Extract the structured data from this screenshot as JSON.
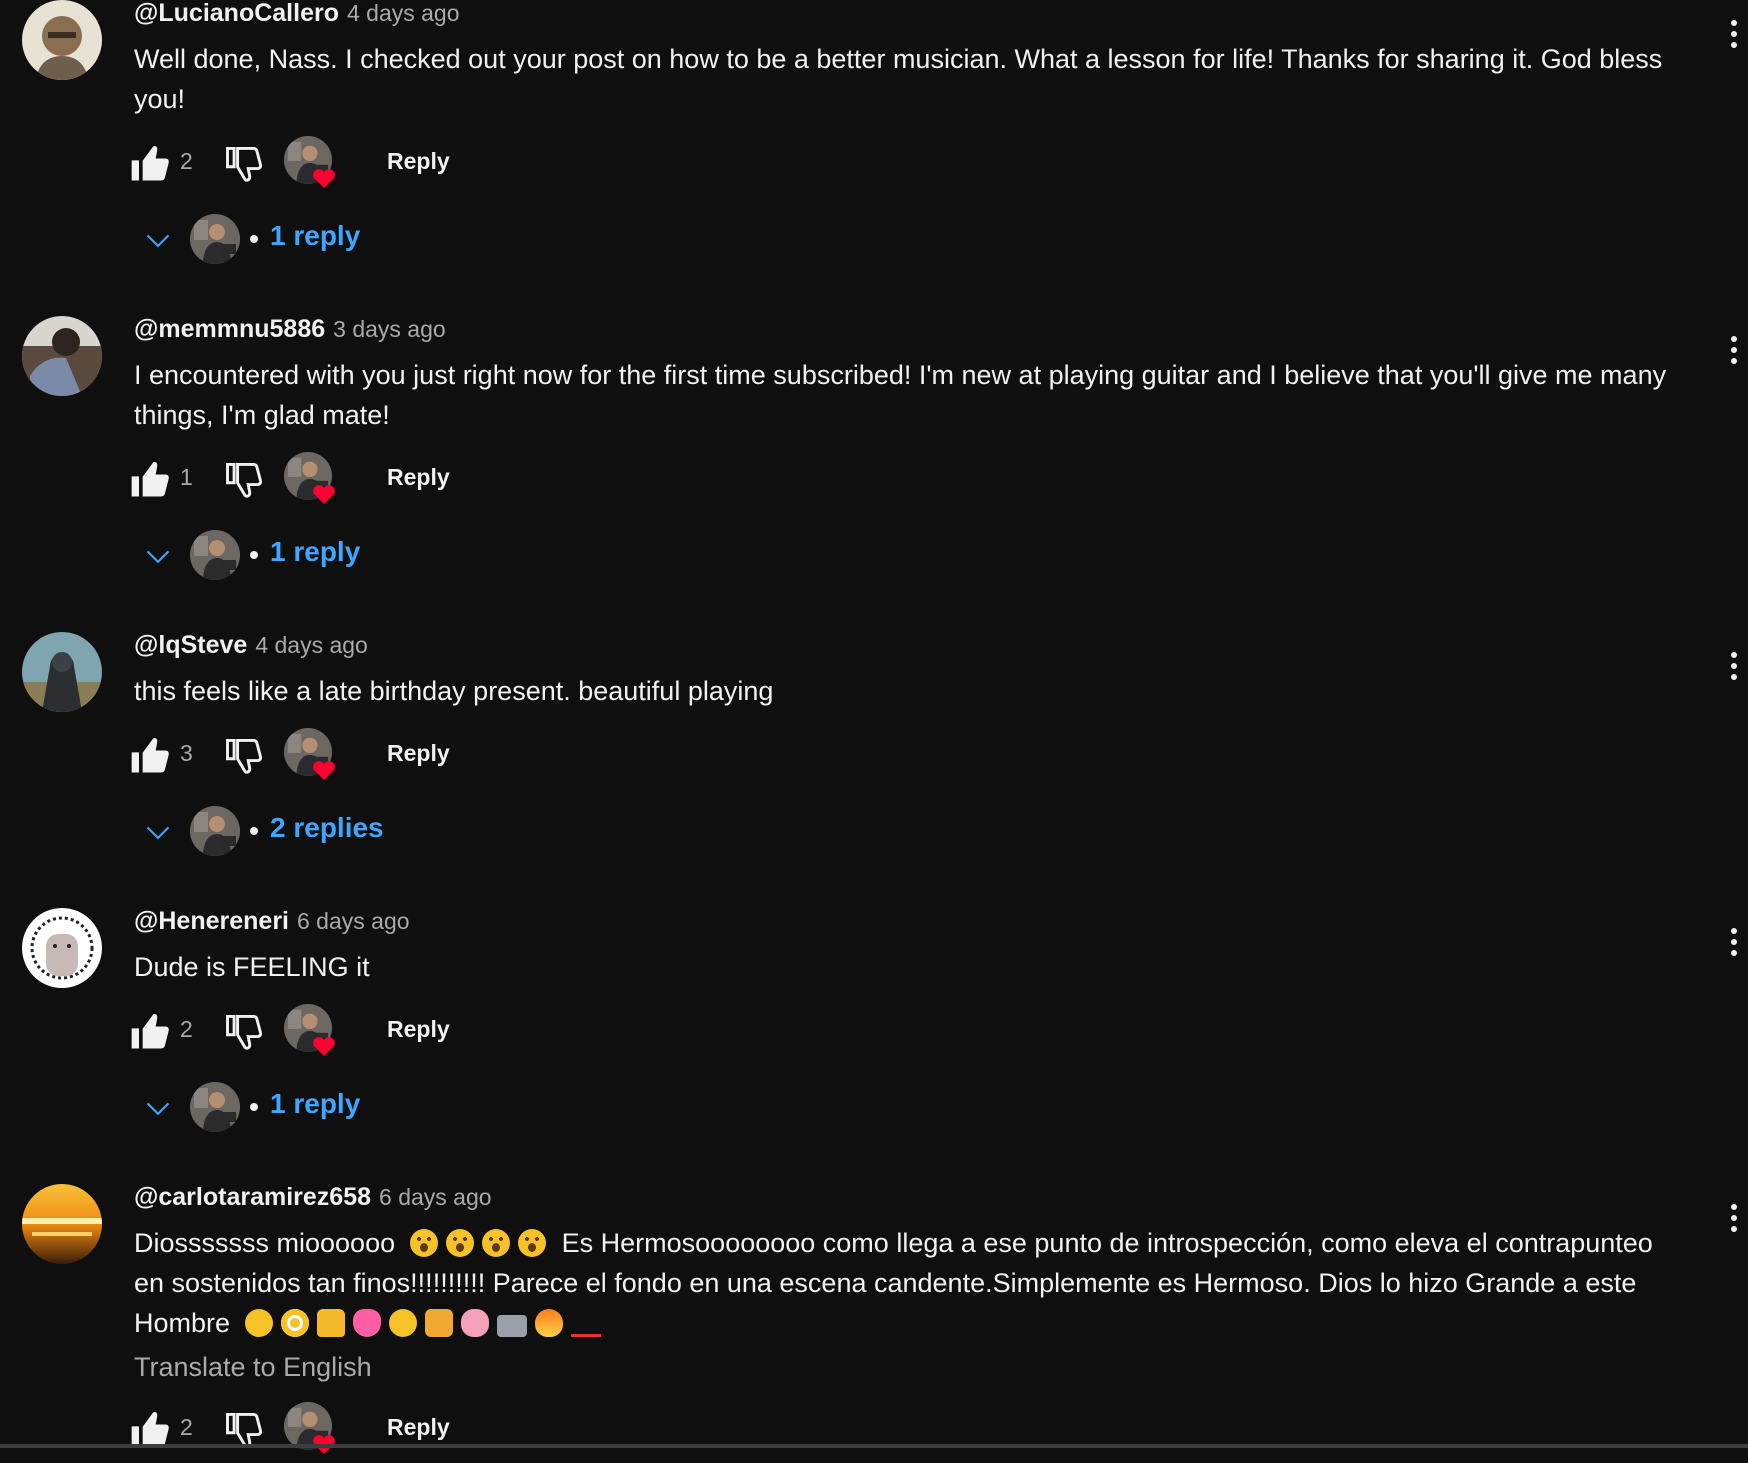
{
  "comments": [
    {
      "author": "@LucianoCallero",
      "time": "4 days ago",
      "text": "Well done, Nass. I checked out your post on how to be a better musician. What a lesson for life! Thanks for sharing it. God bless you!",
      "likes": "2",
      "reply_label": "Reply",
      "replies_label": "1 reply"
    },
    {
      "author": "@memmnu5886",
      "time": "3 days ago",
      "text": "I encountered with you just right now for the first time subscribed! I'm new at playing guitar and I believe that you'll give me many things, I'm glad mate!",
      "likes": "1",
      "reply_label": "Reply",
      "replies_label": "1 reply"
    },
    {
      "author": "@lqSteve",
      "time": "4 days ago",
      "text": "this feels like a late birthday present. beautiful playing",
      "likes": "3",
      "reply_label": "Reply",
      "replies_label": "2 replies"
    },
    {
      "author": "@Henereneri",
      "time": "6 days ago",
      "text": "Dude is FEELING it",
      "likes": "2",
      "reply_label": "Reply",
      "replies_label": "1 reply"
    },
    {
      "author": "@carlotaramirez658",
      "time": "6 days ago",
      "text_part1": "Diosssssss mioooooo",
      "text_part2": "Es Hermosoooooooo como llega a ese punto de introspección, como eleva el contrapunteo en sostenidos tan finos!!!!!!!!!! Parece el fondo en una escena candente.Simplemente es Hermoso. Dios lo hizo Grande a este Hombre",
      "translate_label": "Translate to English",
      "likes": "2",
      "reply_label": "Reply"
    }
  ],
  "colors": {
    "background": "#0f0f0f",
    "link_blue": "#3ea6ff",
    "heart_red": "#ff0033",
    "muted_text": "#aaaaaa"
  },
  "emoji_names": [
    "astonished",
    "astonished",
    "astonished",
    "astonished",
    "kissing",
    "pleading",
    "thumbs-up",
    "two-hearts",
    "smiling",
    "fist",
    "brain",
    "balance-scale",
    "fire",
    "hundred-points"
  ]
}
